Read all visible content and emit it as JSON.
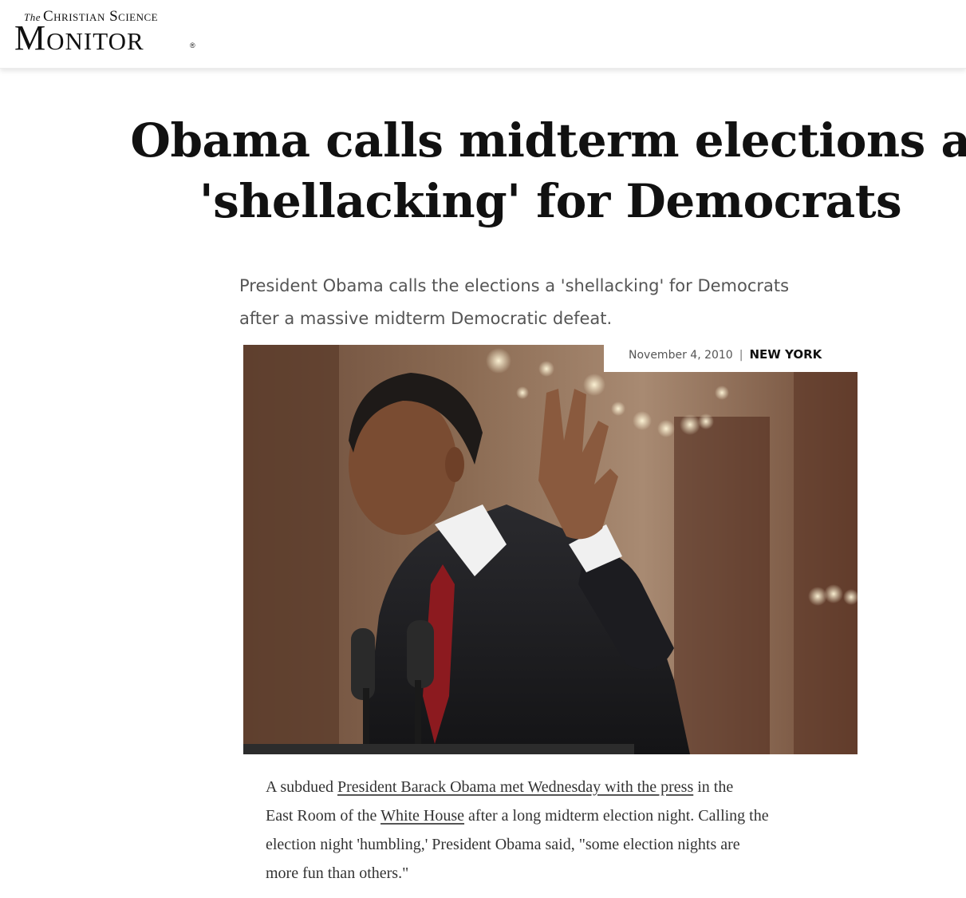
{
  "masthead": {
    "logo_the": "The",
    "logo_small": "Christian Science",
    "logo_big": "Monitor",
    "logo_reg": "®"
  },
  "article": {
    "headline_line1": "Obama calls midterm elections a",
    "headline_line2": "'shellacking' for Democrats",
    "dek_line1": "President Obama calls the elections a 'shellacking' for Democrats",
    "dek_line2": "after a massive midterm Democratic defeat.",
    "date": "November 4, 2010",
    "separator": "|",
    "location": "NEW YORK",
    "body": {
      "p1_a": "A subdued ",
      "p1_link1": "President Barack Obama met Wednesday with the press",
      "p1_b": " in the",
      "p2_a": "East Room of the ",
      "p2_link2": "White House",
      "p2_b": " after a long midterm election night. Calling the",
      "p3": "election night 'humbling,' President Obama said, \"some election nights are",
      "p4": "more fun than others.\""
    }
  },
  "photo": {
    "subject": "president-at-podium-icon"
  },
  "colors": {
    "text": "#111111",
    "dek": "#555555",
    "link_underline": "#555555"
  }
}
